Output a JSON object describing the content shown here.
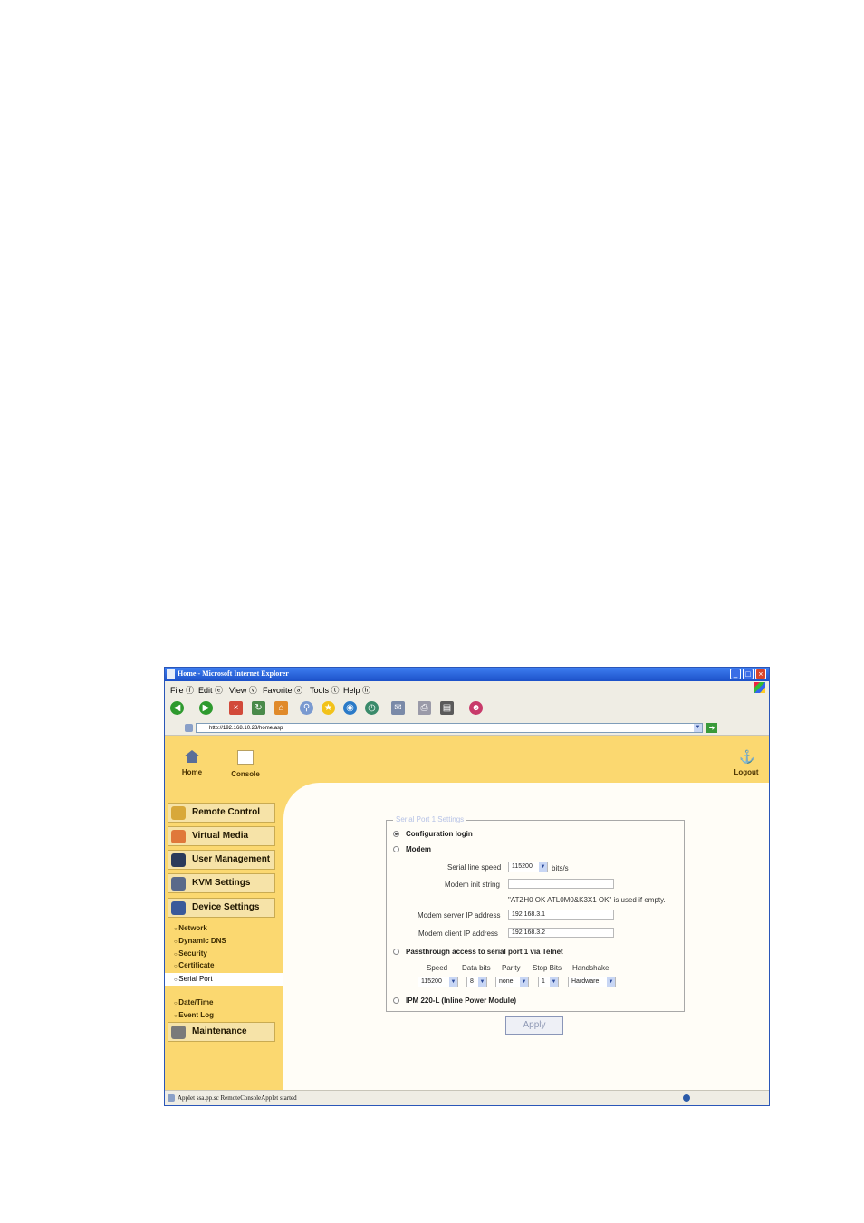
{
  "window": {
    "title": "Home - Microsoft Internet Explorer"
  },
  "menubar": {
    "file": "File ⓕ",
    "edit": "Edit ⓔ",
    "view": "View ⓥ",
    "favorite": "Favorite ⓐ",
    "tools": "Tools ⓣ",
    "help": "Help ⓗ"
  },
  "address": {
    "url": "http://192.168.10.23/home.asp"
  },
  "topnav": {
    "home": "Home",
    "console": "Console",
    "logout": "Logout"
  },
  "sidebar": {
    "remote_control": "Remote Control",
    "virtual_media": "Virtual Media",
    "user_management": "User Management",
    "kvm_settings": "KVM Settings",
    "device_settings": "Device Settings",
    "sub_network": "Network",
    "sub_dynamic_dns": "Dynamic DNS",
    "sub_security": "Security",
    "sub_certificate": "Certificate",
    "sub_serial_port": "Serial Port",
    "sub_date_time": "Date/Time",
    "sub_event_log": "Event Log",
    "maintenance": "Maintenance"
  },
  "form": {
    "legend": "Serial Port 1 Settings",
    "opt_config_login": "Configuration login",
    "opt_modem": "Modem",
    "serial_line_speed_label": "Serial line speed",
    "serial_line_speed_value": "115200",
    "bits_per_sec": "bits/s",
    "modem_init_label": "Modem init string",
    "modem_init_value": "",
    "modem_init_note": "\"ATZH0 OK ATL0M0&K3X1 OK\" is used if empty.",
    "modem_server_ip_label": "Modem server IP address",
    "modem_server_ip_value": "192.168.3.1",
    "modem_client_ip_label": "Modem client IP address",
    "modem_client_ip_value": "192.168.3.2",
    "opt_passthrough": "Passthrough access to serial port 1 via Telnet",
    "col_speed": "Speed",
    "col_data_bits": "Data bits",
    "col_parity": "Parity",
    "col_stop_bits": "Stop Bits",
    "col_handshake": "Handshake",
    "speed_value": "115200",
    "data_bits_value": "8",
    "parity_value": "none",
    "stop_bits_value": "1",
    "handshake_value": "Hardware",
    "opt_ipm": "IPM 220-L (Inline Power Module)",
    "apply": "Apply"
  },
  "status": {
    "text": "Applet ssa.pp.sc RemoteConsoleApplet started"
  },
  "colors": {
    "page_yellow": "#fbd870",
    "menu_button": "#f6e3a8",
    "titlebar_blue": "#1c50c8",
    "legend_text": "#b6c2e6"
  }
}
